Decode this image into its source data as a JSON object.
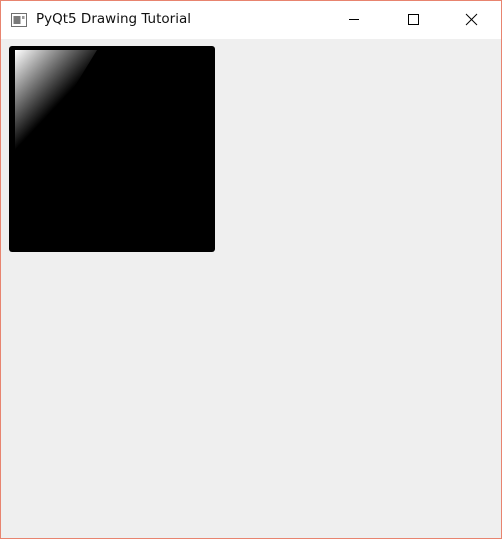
{
  "window": {
    "title": "PyQt5 Drawing Tutorial",
    "border_color": "#e8846f",
    "client_background": "#efefef",
    "controls": {
      "minimize_icon": "minimize-icon",
      "maximize_icon": "maximize-icon",
      "close_icon": "close-icon"
    }
  },
  "canvas": {
    "fill": "black",
    "gradient": {
      "type": "linear",
      "from_color": "white",
      "to_color": "black"
    }
  }
}
